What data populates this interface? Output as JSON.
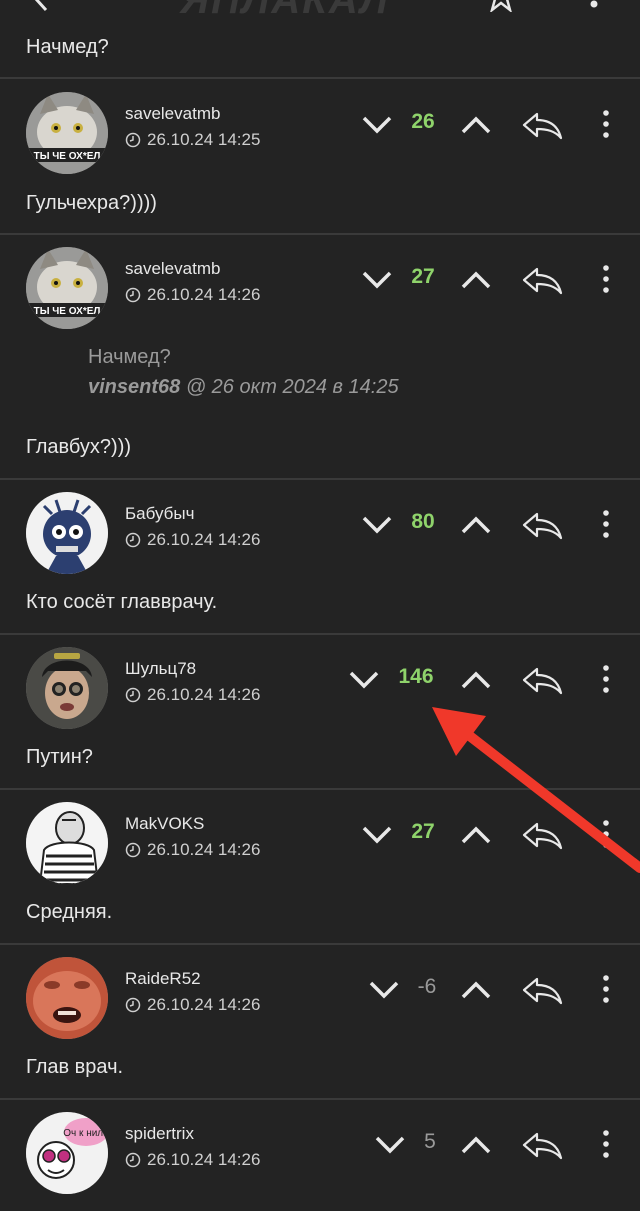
{
  "header": {
    "logo": "ЯПЛАКАЛ",
    "back_icon": "chevron-left-icon",
    "star_icon": "star-icon",
    "more_icon": "kebab-icon"
  },
  "top_text": "Начмед?",
  "colors": {
    "positive": "#8fd36b",
    "neutral": "#9a9a9a",
    "arrow": "#f0382a"
  },
  "comments": [
    {
      "user": "savelevatmb",
      "time": "26.10.24 14:25",
      "score": "26",
      "text": "Гульчехра?))))",
      "avatar_label": "ТЫ ЧЕ ОХ*ЕЛ"
    },
    {
      "user": "savelevatmb",
      "time": "26.10.24 14:26",
      "score": "27",
      "quote": "Начмед?",
      "quote_author": "vinsent68",
      "quote_suffix": " @ 26 окт 2024 в 14:25",
      "text": "Главбух?)))",
      "avatar_label": "ТЫ ЧЕ ОХ*ЕЛ"
    },
    {
      "user": "Бабубыч",
      "time": "26.10.24 14:26",
      "score": "80",
      "text": "Кто сосёт главврачу."
    },
    {
      "user": "Шульц78",
      "time": "26.10.24 14:26",
      "score": "146",
      "text": "Путин?"
    },
    {
      "user": "MakVOKS",
      "time": "26.10.24 14:26",
      "score": "27",
      "text": "Средняя."
    },
    {
      "user": "RaideR52",
      "time": "26.10.24 14:26",
      "score": "-6",
      "text": "Глав врач."
    },
    {
      "user": "spidertrix",
      "time": "26.10.24 14:26",
      "score": "5",
      "avatar_label": "Оч к нила"
    }
  ]
}
